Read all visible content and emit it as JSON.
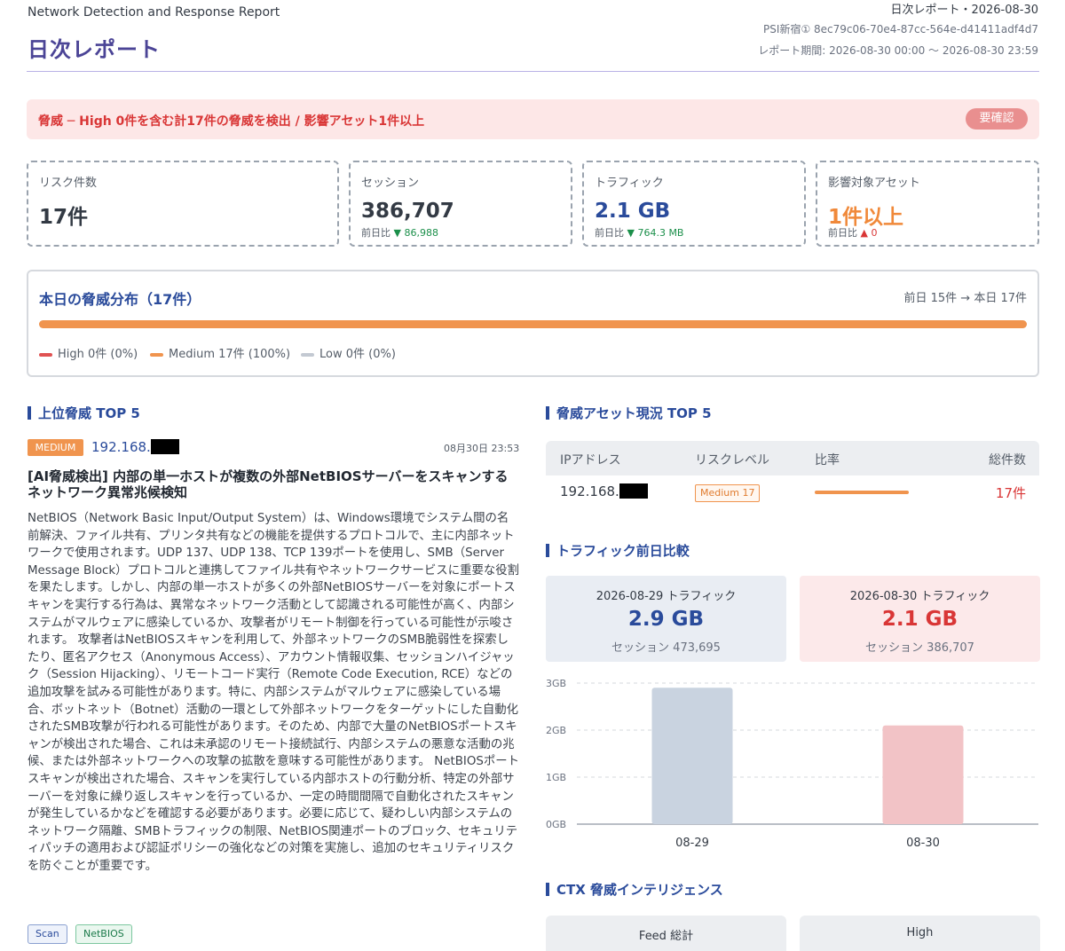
{
  "header": {
    "subtitle": "Network Detection and Response Report",
    "title": "日次レポート",
    "report_date": "日次レポート・2026-08-30",
    "psi_id": "PSI新宿① 8ec79c06-70e4-87cc-564e-d41411adf4d7",
    "period": "レポート期間: 2026-08-30 00:00 〜 2026-08-30 23:59"
  },
  "alert": {
    "text": "脅威 ─ High 0件を含む計17件の脅威を検出 / 影響アセット1件以上",
    "badge": "要確認"
  },
  "metrics": [
    {
      "label": "リスク件数",
      "value": "17件",
      "delta_label": "",
      "delta": "",
      "direction": "",
      "value_color": "#333a44"
    },
    {
      "label": "セッション",
      "value": "386,707",
      "delta_label": "前日比",
      "delta": "▼ 86,988",
      "direction": "down",
      "value_color": "#333a44"
    },
    {
      "label": "トラフィック",
      "value": "2.1 GB",
      "delta_label": "前日比",
      "delta": "▼ 764.3 MB",
      "direction": "down",
      "value_color": "#2a4b9b"
    },
    {
      "label": "影響対象アセット",
      "value": "1件以上",
      "delta_label": "前日比",
      "delta": "▲ 0",
      "direction": "up",
      "value_color": "#f0893a"
    }
  ],
  "distribution": {
    "title": "本日の脅威分布（17件）",
    "compare": "前日 15件 → 本日 17件",
    "segments": [
      {
        "name": "High",
        "label": "High 0件 (0%)",
        "fraction": 0.0,
        "color": "#e05252"
      },
      {
        "name": "Medium",
        "label": "Medium 17件 (100%)",
        "fraction": 1.0,
        "color": "#f0944e"
      },
      {
        "name": "Low",
        "label": "Low 0件 (0%)",
        "fraction": 0.0,
        "color": "#c3c9d2"
      }
    ]
  },
  "top_threats": {
    "heading": "上位脅威 TOP 5",
    "items": [
      {
        "severity": "MEDIUM",
        "ip": "192.168.",
        "time": "08月30日 23:53",
        "title": "[AI脅威検出] 内部の単一ホストが複数の外部NetBIOSサーバーをスキャンするネットワーク異常兆候検知",
        "body": "NetBIOS（Network Basic Input/Output System）は、Windows環境でシステム間の名前解決、ファイル共有、プリンタ共有などの機能を提供するプロトコルで、主に内部ネットワークで使用されます。UDP 137、UDP 138、TCP 139ポートを使用し、SMB（Server Message Block）プロトコルと連携してファイル共有やネットワークサービスに重要な役割を果たします。しかし、内部の単一ホストが多くの外部NetBIOSサーバーを対象にポートスキャンを実行する行為は、異常なネットワーク活動として認識される可能性が高く、内部システムがマルウェアに感染しているか、攻撃者がリモート制御を行っている可能性が示唆されます。 攻撃者はNetBIOSスキャンを利用して、外部ネットワークのSMB脆弱性を探索したり、匿名アクセス（Anonymous Access）、アカウント情報収集、セッションハイジャック（Session Hijacking）、リモートコード実行（Remote Code Execution, RCE）などの追加攻撃を試みる可能性があります。特に、内部システムがマルウェアに感染している場合、ボットネット（Botnet）活動の一環として外部ネットワークをターゲットにした自動化されたSMB攻撃が行われる可能性があります。そのため、内部で大量のNetBIOSポートスキャンが検出された場合、これは未承認のリモート接続試行、内部システムの悪意な活動の兆候、または外部ネットワークへの攻撃の拡散を意味する可能性があります。 NetBIOSポートスキャンが検出された場合、スキャンを実行している内部ホストの行動分析、特定の外部サーバーを対象に繰り返しスキャンを行っているか、一定の時間間隔で自動化されたスキャンが発生しているかなどを確認する必要があります。必要に応じて、疑わしい内部システムのネットワーク隔離、SMBトラフィックの制限、NetBIOS関連ポートのブロック、セキュリティパッチの適用および認証ポリシーの強化などの対策を実施し、追加のセキュリティリスクを防ぐことが重要です。",
        "tags": [
          "Scan",
          "NetBIOS"
        ]
      }
    ]
  },
  "asset_table": {
    "heading": "脅威アセット現況 TOP 5",
    "columns": [
      "IPアドレス",
      "リスクレベル",
      "比率",
      "総件数"
    ],
    "rows": [
      {
        "ip": "192.168.",
        "level": "Medium 17",
        "ratio": 1.0,
        "total": "17件"
      }
    ]
  },
  "traffic": {
    "heading": "トラフィック前日比較",
    "prev": {
      "label": "2026-08-29 トラフィック",
      "value": "2.9 GB",
      "sessions": "セッション 473,695"
    },
    "curr": {
      "label": "2026-08-30 トラフィック",
      "value": "2.1 GB",
      "sessions": "セッション 386,707"
    }
  },
  "chart_data": {
    "type": "bar",
    "categories": [
      "08-29",
      "08-30"
    ],
    "values": [
      2.9,
      2.1
    ],
    "unit": "GB",
    "ylim": [
      0,
      3
    ],
    "yticks": [
      "0GB",
      "1GB",
      "2GB",
      "3GB"
    ],
    "colors": [
      "#c9d3e0",
      "#f2c3c6"
    ],
    "grid": true
  },
  "intel": {
    "heading": "CTX 脅威インテリジェンス",
    "cards": [
      "Feed 総計",
      "High"
    ]
  },
  "colors": {
    "accent": "#2a4b9b",
    "title": "#4b4496",
    "high": "#e05252",
    "medium": "#f0944e",
    "low": "#c3c9d2"
  }
}
